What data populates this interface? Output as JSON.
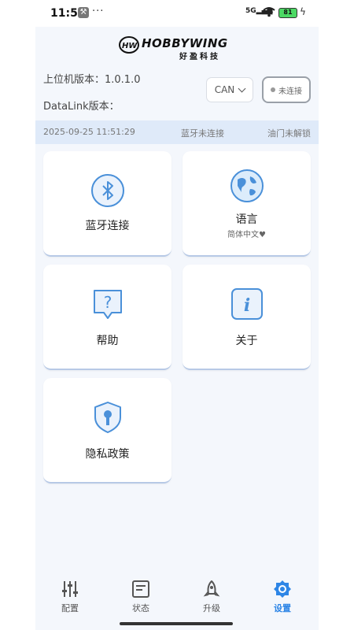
{
  "status_bar": {
    "time": "11:51",
    "dots": "···",
    "network": "5G",
    "battery": "81"
  },
  "brand": {
    "name": "HOBBYWING",
    "cn_name": "好盈科技"
  },
  "versions": {
    "host_label": "上位机版本：1.0.1.0",
    "datalink_label": "DataLink版本："
  },
  "controls": {
    "protocol_value": "CAN",
    "connection_status": "未连接"
  },
  "info_strip": {
    "datetime": "2025-09-25 11:51:29",
    "bluetooth": "蓝牙未连接",
    "throttle": "油门未解锁"
  },
  "cards": {
    "bluetooth": {
      "label": "蓝牙连接"
    },
    "language": {
      "label": "语言",
      "sub": "简体中文♥"
    },
    "help": {
      "label": "帮助"
    },
    "about": {
      "label": "关于"
    },
    "privacy": {
      "label": "隐私政策"
    }
  },
  "tabs": {
    "config": "配置",
    "status": "状态",
    "upgrade": "升级",
    "settings": "设置"
  },
  "colors": {
    "accent": "#2e86e6",
    "icon_blue": "#4a90d9",
    "strip_bg": "#dfeaf9",
    "app_bg": "#f4f7fc"
  }
}
